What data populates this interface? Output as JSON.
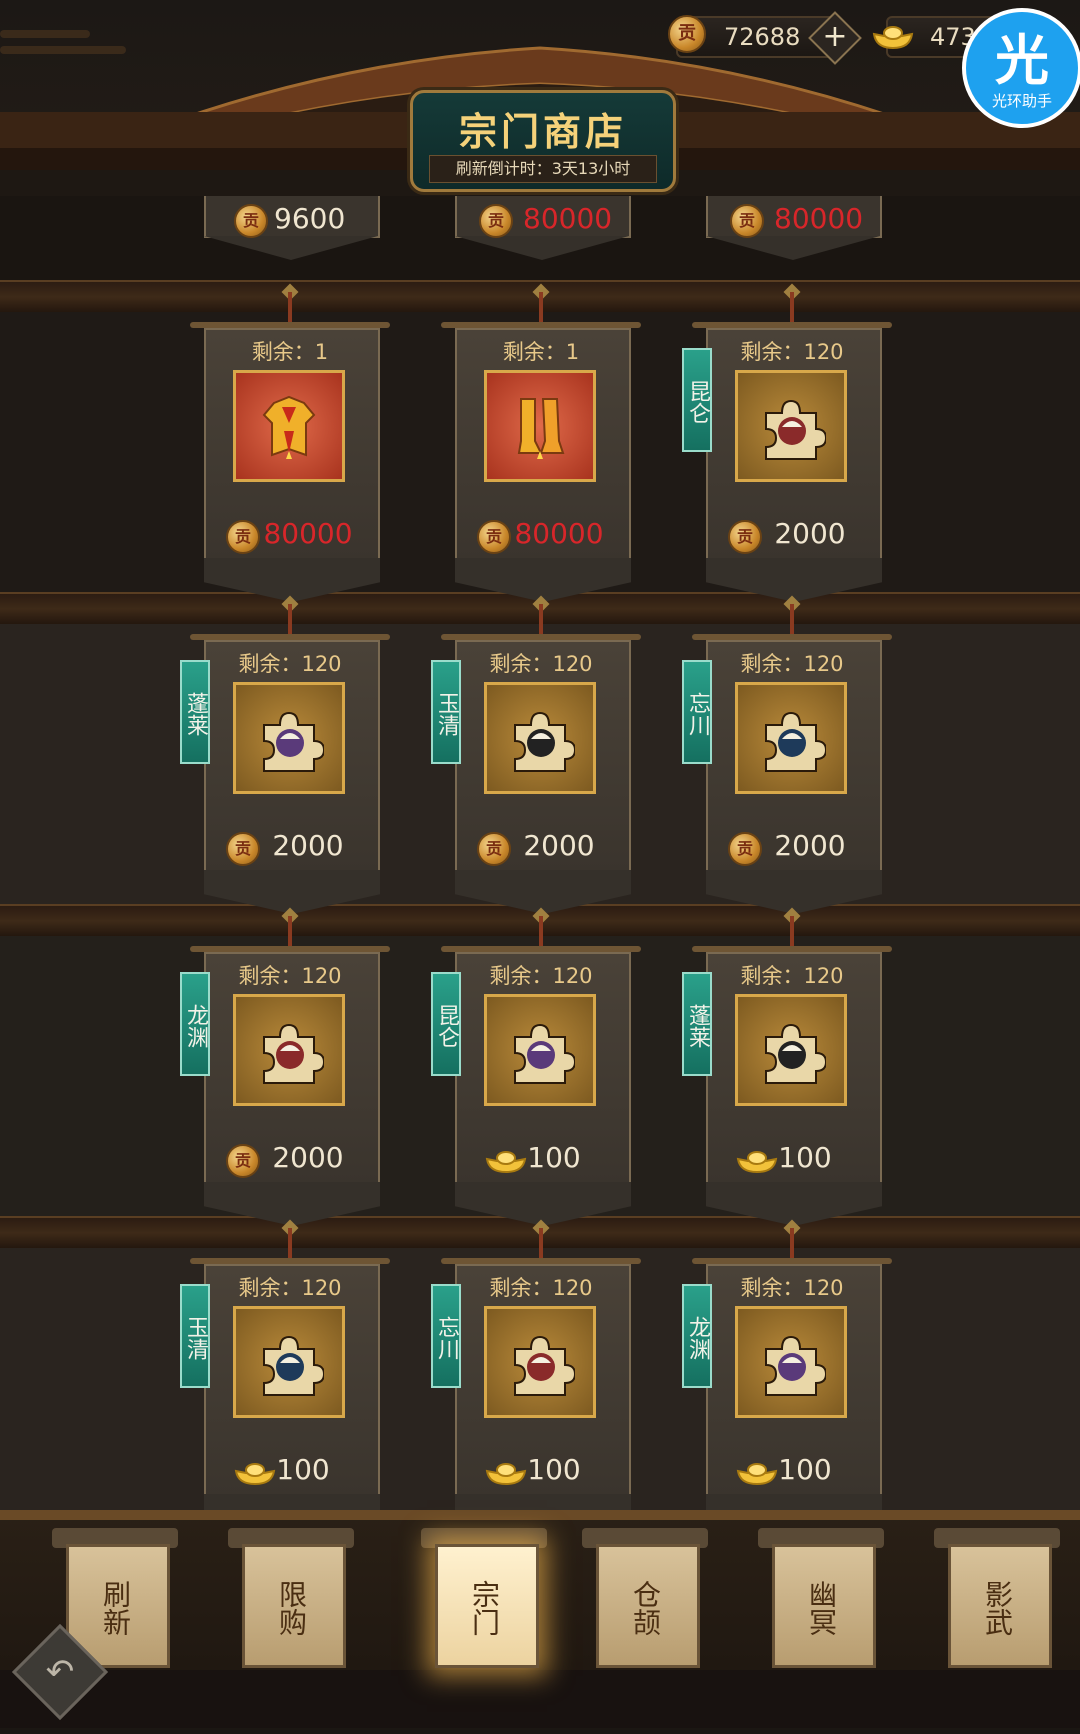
{
  "header": {
    "title": "宗门商店",
    "refresh_countdown": "刷新倒计时：3天13小时",
    "contribution_balance": "72688",
    "gold_balance": "473",
    "coin_symbol": "贡"
  },
  "top_row_prices": [
    {
      "price": "9600",
      "price_color": "normal"
    },
    {
      "price": "80000",
      "price_color": "red"
    },
    {
      "price": "80000",
      "price_color": "red"
    }
  ],
  "shop_items": [
    {
      "remaining": "剩余：1",
      "sect": "",
      "item": "armor-icon",
      "currency": "contribution",
      "price": "80000",
      "price_color": "red"
    },
    {
      "remaining": "剩余：1",
      "sect": "",
      "item": "boots-icon",
      "currency": "contribution",
      "price": "80000",
      "price_color": "red"
    },
    {
      "remaining": "剩余：120",
      "sect": "昆仑",
      "item": "hero-fragment-icon",
      "currency": "contribution",
      "price": "2000",
      "price_color": "normal"
    },
    {
      "remaining": "剩余：120",
      "sect": "蓬莱",
      "item": "hero-fragment-icon",
      "currency": "contribution",
      "price": "2000",
      "price_color": "normal"
    },
    {
      "remaining": "剩余：120",
      "sect": "玉清",
      "item": "hero-fragment-icon",
      "currency": "contribution",
      "price": "2000",
      "price_color": "normal"
    },
    {
      "remaining": "剩余：120",
      "sect": "忘川",
      "item": "hero-fragment-icon",
      "currency": "contribution",
      "price": "2000",
      "price_color": "normal"
    },
    {
      "remaining": "剩余：120",
      "sect": "龙渊",
      "item": "hero-fragment-icon",
      "currency": "contribution",
      "price": "2000",
      "price_color": "normal"
    },
    {
      "remaining": "剩余：120",
      "sect": "昆仑",
      "item": "hero-fragment-icon",
      "currency": "gold",
      "price": "100",
      "price_color": "normal"
    },
    {
      "remaining": "剩余：120",
      "sect": "蓬莱",
      "item": "hero-fragment-icon",
      "currency": "gold",
      "price": "100",
      "price_color": "normal"
    },
    {
      "remaining": "剩余：120",
      "sect": "玉清",
      "item": "hero-fragment-icon",
      "currency": "gold",
      "price": "100",
      "price_color": "normal"
    },
    {
      "remaining": "剩余：120",
      "sect": "忘川",
      "item": "hero-fragment-icon",
      "currency": "gold",
      "price": "100",
      "price_color": "normal"
    },
    {
      "remaining": "剩余：120",
      "sect": "龙渊",
      "item": "hero-fragment-icon",
      "currency": "gold",
      "price": "100",
      "price_color": "normal"
    }
  ],
  "nav_tabs": [
    {
      "label": "刷新",
      "active": false
    },
    {
      "label": "限购",
      "active": false
    },
    {
      "label": "宗门",
      "active": true
    },
    {
      "label": "仓颉",
      "active": false
    },
    {
      "label": "幽冥",
      "active": false
    },
    {
      "label": "影武",
      "active": false
    }
  ],
  "watermark": {
    "char": "光",
    "text": "光环助手"
  },
  "colors": {
    "accent_gold": "#f5d27a",
    "price_red": "#d8262a",
    "sect_tag_teal": "#2aa08a",
    "frame_gold": "#d8a84a",
    "frame_red": "#e06a4a",
    "watermark_blue": "#1ea1ef",
    "fragment_art": [
      "#222222",
      "#1e3a5a",
      "#8a2a2a",
      "#5a3a7a"
    ]
  }
}
